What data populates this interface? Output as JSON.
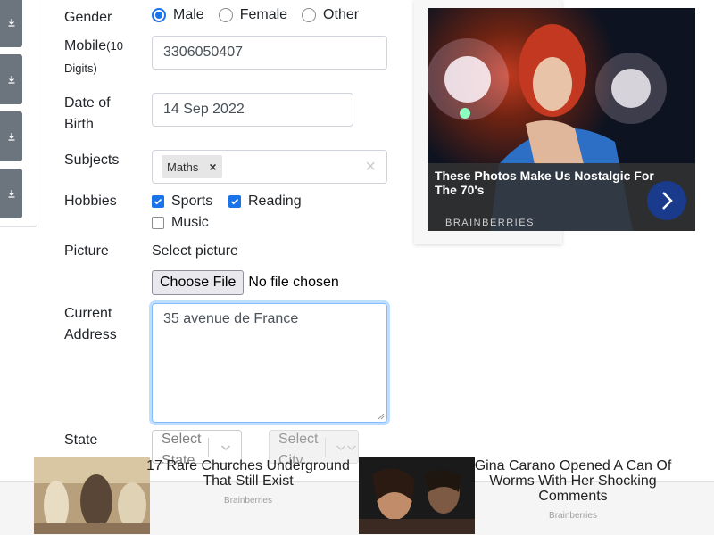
{
  "form": {
    "gender": {
      "label": "Gender",
      "options": [
        "Male",
        "Female",
        "Other"
      ],
      "selected": "Male"
    },
    "mobile": {
      "label": "Mobile",
      "hint": "(10",
      "hint2": "Digits)",
      "value": "3306050407"
    },
    "dob": {
      "label_line1": "Date of",
      "label_line2": "Birth",
      "value": "14 Sep 2022"
    },
    "subjects": {
      "label": "Subjects",
      "chips": [
        "Maths"
      ],
      "chip_remove": "×",
      "clear": "×"
    },
    "hobbies": {
      "label": "Hobbies",
      "items": [
        {
          "label": "Sports",
          "checked": true
        },
        {
          "label": "Reading",
          "checked": true
        },
        {
          "label": "Music",
          "checked": false
        }
      ]
    },
    "picture": {
      "label": "Picture",
      "select_label": "Select picture",
      "button": "Choose File",
      "status": "No file chosen"
    },
    "address": {
      "label_line1": "Current",
      "label_line2": "Address",
      "value": "35 avenue de France"
    },
    "state": {
      "label": "State",
      "placeholder_line1": "Select",
      "placeholder_line2": "State"
    },
    "city": {
      "placeholder_line1": "Select",
      "placeholder_line2": "City"
    }
  },
  "ad_right": {
    "title": "These Photos Make Us Nostalgic For The 70's",
    "brand": "BRAINBERRIES"
  },
  "ad_bottom": [
    {
      "title": "17 Rare Churches Underground That Still Exist",
      "brand": "Brainberries"
    },
    {
      "title": "Gina Carano Opened A Can Of Worms With Her Shocking Comments",
      "brand": "Brainberries"
    }
  ]
}
